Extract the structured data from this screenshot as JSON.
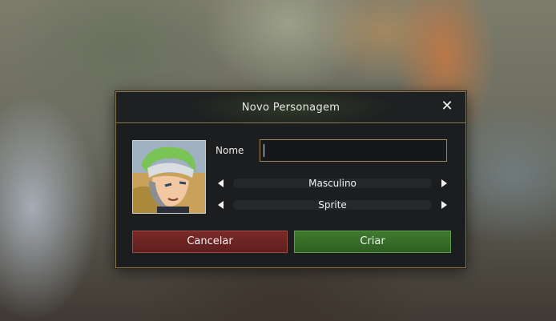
{
  "dialog": {
    "title": "Novo Personagem",
    "close_icon": "close-icon"
  },
  "form": {
    "name_label": "Nome",
    "name_value": "",
    "gender": "Masculino",
    "sprite": "Sprite"
  },
  "buttons": {
    "cancel_label": "Cancelar",
    "create_label": "Criar"
  },
  "colors": {
    "border": "#8a7650",
    "cancel": "#6e2624",
    "create": "#3b6f2c"
  }
}
